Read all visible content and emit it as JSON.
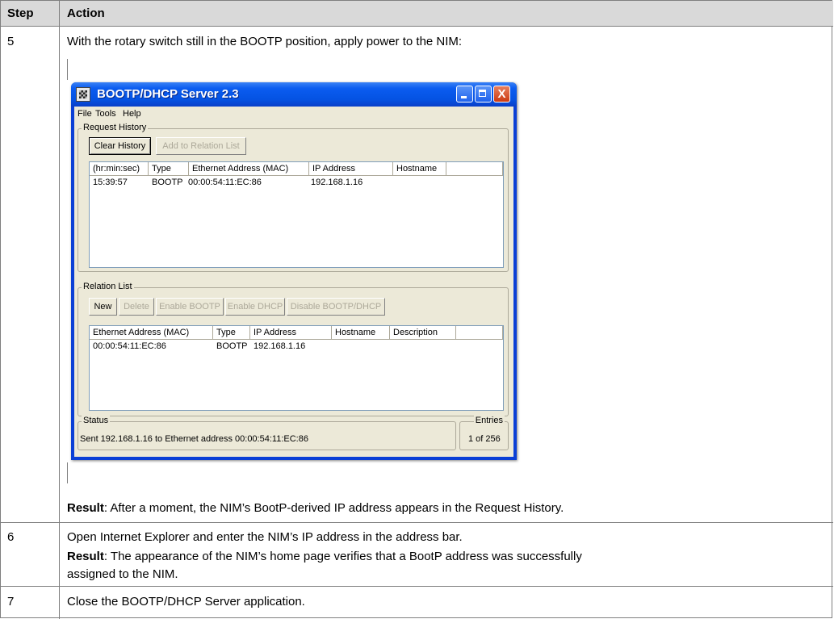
{
  "table": {
    "header": {
      "step": "Step",
      "action": "Action"
    },
    "rows": [
      {
        "step": "5",
        "text": "With the rotary switch still in the BOOTP position, apply power to the NIM:",
        "result_label": "Result",
        "result_text": ": After a moment, the NIM’s BootP-derived IP address appears in the Request History."
      },
      {
        "step": "6",
        "text": "Open Internet Explorer and enter the NIM’s IP address in the address bar.",
        "result_label": "Result",
        "result_text_1": ": The appearance of the NIM’s home page verifies that a BootP address was successfully",
        "result_text_2": "assigned to the NIM."
      },
      {
        "step": "7",
        "text": "Close the BOOTP/DHCP Server application."
      }
    ]
  },
  "window": {
    "title": "BOOTP/DHCP Server 2.3",
    "close_glyph": "X",
    "menu": [
      "File",
      "Tools",
      "Help"
    ],
    "request_history": {
      "label": "Request History",
      "buttons": [
        "Clear History",
        "Add to Relation List"
      ],
      "columns": [
        "(hr:min:sec)",
        "Type",
        "Ethernet Address (MAC)",
        "IP Address",
        "Hostname"
      ],
      "rows": [
        {
          "time": "15:39:57",
          "type": "BOOTP",
          "mac": "00:00:54:11:EC:86",
          "ip": "192.168.1.16",
          "hostname": ""
        }
      ]
    },
    "relation_list": {
      "label": "Relation List",
      "buttons": [
        "New",
        "Delete",
        "Enable BOOTP",
        "Enable DHCP",
        "Disable BOOTP/DHCP"
      ],
      "columns": [
        "Ethernet Address (MAC)",
        "Type",
        "IP Address",
        "Hostname",
        "Description"
      ],
      "rows": [
        {
          "mac": "00:00:54:11:EC:86",
          "type": "BOOTP",
          "ip": "192.168.1.16",
          "hostname": "",
          "description": ""
        }
      ]
    },
    "status": {
      "label": "Status",
      "text": "Sent 192.168.1.16 to Ethernet address 00:00:54:11:EC:86"
    },
    "entries": {
      "label": "Entries",
      "text": "1 of 256"
    }
  }
}
